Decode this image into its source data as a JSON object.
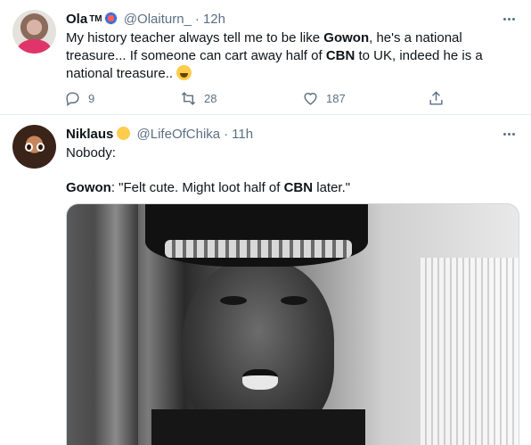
{
  "tweet1": {
    "name": "Ola",
    "badge": "TM",
    "handle": "@Olaiturn_",
    "time": "12h",
    "text_parts": {
      "p1": "My history teacher always tell me to be like ",
      "b1": "Gowon",
      "p2": ", he's a national treasure... If someone can cart away half of ",
      "b2": "CBN",
      "p3": " to UK, indeed he is a national treasure.."
    },
    "stats": {
      "replies": "9",
      "retweets": "28",
      "likes": "187"
    }
  },
  "tweet2": {
    "name": "Niklaus",
    "handle": "@LifeOfChika",
    "time": "11h",
    "line1": "Nobody:",
    "line2_parts": {
      "b1": "Gowon",
      "p1": ": \"Felt cute. Might loot half of ",
      "b2": "CBN",
      "p2": " later.\""
    }
  },
  "colors": {
    "secondary_text": "#5b7083",
    "divider": "#e6ecf0"
  },
  "icons": [
    "reply-icon",
    "retweet-icon",
    "like-icon",
    "share-icon",
    "more-icon"
  ]
}
